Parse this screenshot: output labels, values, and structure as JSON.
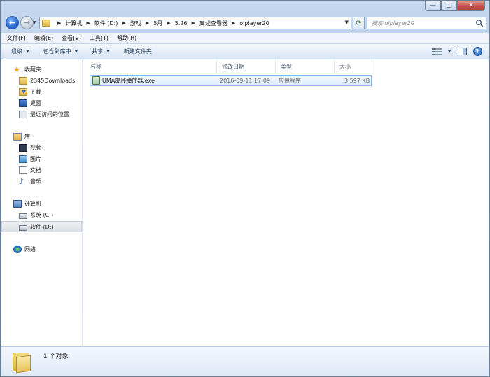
{
  "window": {
    "caption_min": "—",
    "caption_max": "□",
    "caption_close": "✕"
  },
  "address": {
    "crumbs": [
      "计算机",
      "软件 (D:)",
      "游戏",
      "5月",
      "5.26",
      "离线查看器",
      "olplayer20"
    ]
  },
  "search": {
    "placeholder": "搜索 olplayer20"
  },
  "menu": [
    "文件(F)",
    "编辑(E)",
    "查看(V)",
    "工具(T)",
    "帮助(H)"
  ],
  "commands": {
    "organize": "组织",
    "include": "包含到库中",
    "share": "共享",
    "new_folder": "新建文件夹",
    "help": "?"
  },
  "nav": {
    "favorites": "收藏夹",
    "downloads_2345": "2345Downloads",
    "downloads": "下载",
    "desktop": "桌面",
    "recent": "最近访问的位置",
    "libraries": "库",
    "videos": "视频",
    "pictures": "图片",
    "documents": "文档",
    "music": "音乐",
    "computer": "计算机",
    "drive_c": "系统 (C:)",
    "drive_d": "软件 (D:)",
    "network": "网络"
  },
  "columns": {
    "name": "名称",
    "modified": "修改日期",
    "type": "类型",
    "size": "大小"
  },
  "files": [
    {
      "name": "UMA离线播放器.exe",
      "modified": "2016-09-11 17:09",
      "type": "应用程序",
      "size": "3,597 KB"
    }
  ],
  "status": {
    "count": "1 个对象"
  },
  "colors": {
    "accent": "#1e5ec6",
    "selection": "#dcebfc",
    "frame": "#b6cde8"
  }
}
